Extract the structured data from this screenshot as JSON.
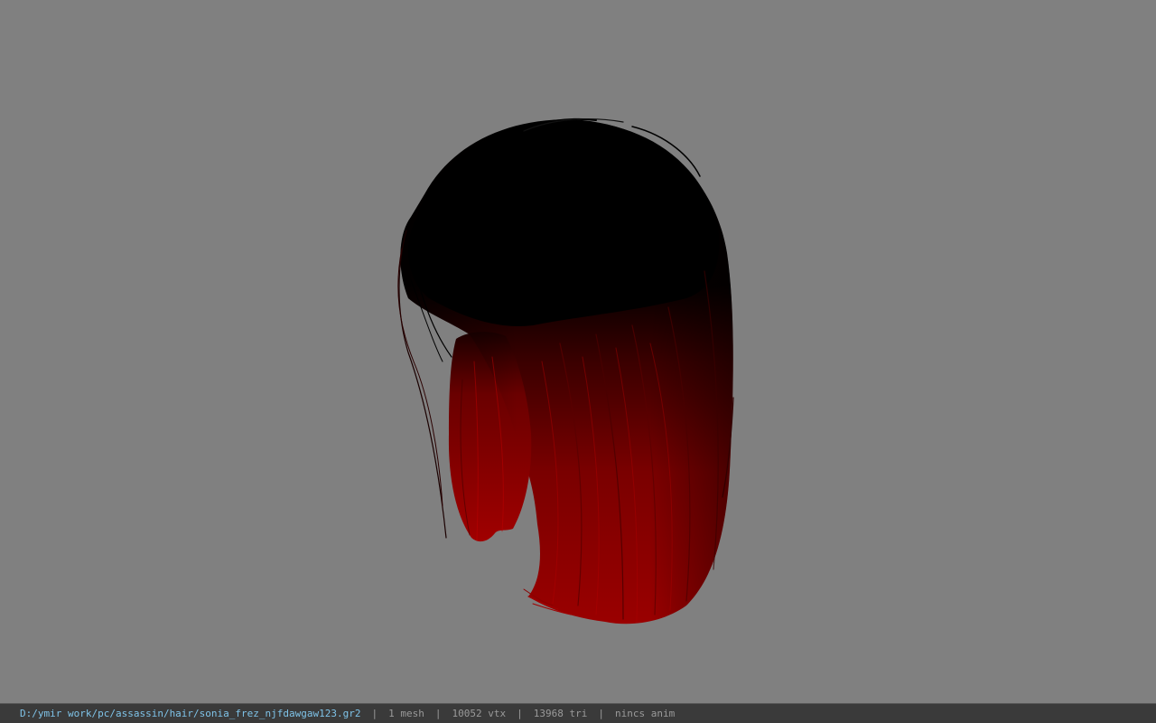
{
  "viewport": {
    "background_color": "#808080",
    "model": {
      "icon": "hair-mesh-model",
      "root_color": "#000000",
      "tip_color": "#a00000"
    }
  },
  "status": {
    "file_path": "D:/ymir work/pc/assassin/hair/sonia_frez_njfdawgaw123.gr2",
    "separator": "|",
    "mesh": "1 mesh",
    "vertices": "10052 vtx",
    "triangles": "13968 tri",
    "anim": "nincs anim",
    "path_color": "#7fc3e8"
  }
}
